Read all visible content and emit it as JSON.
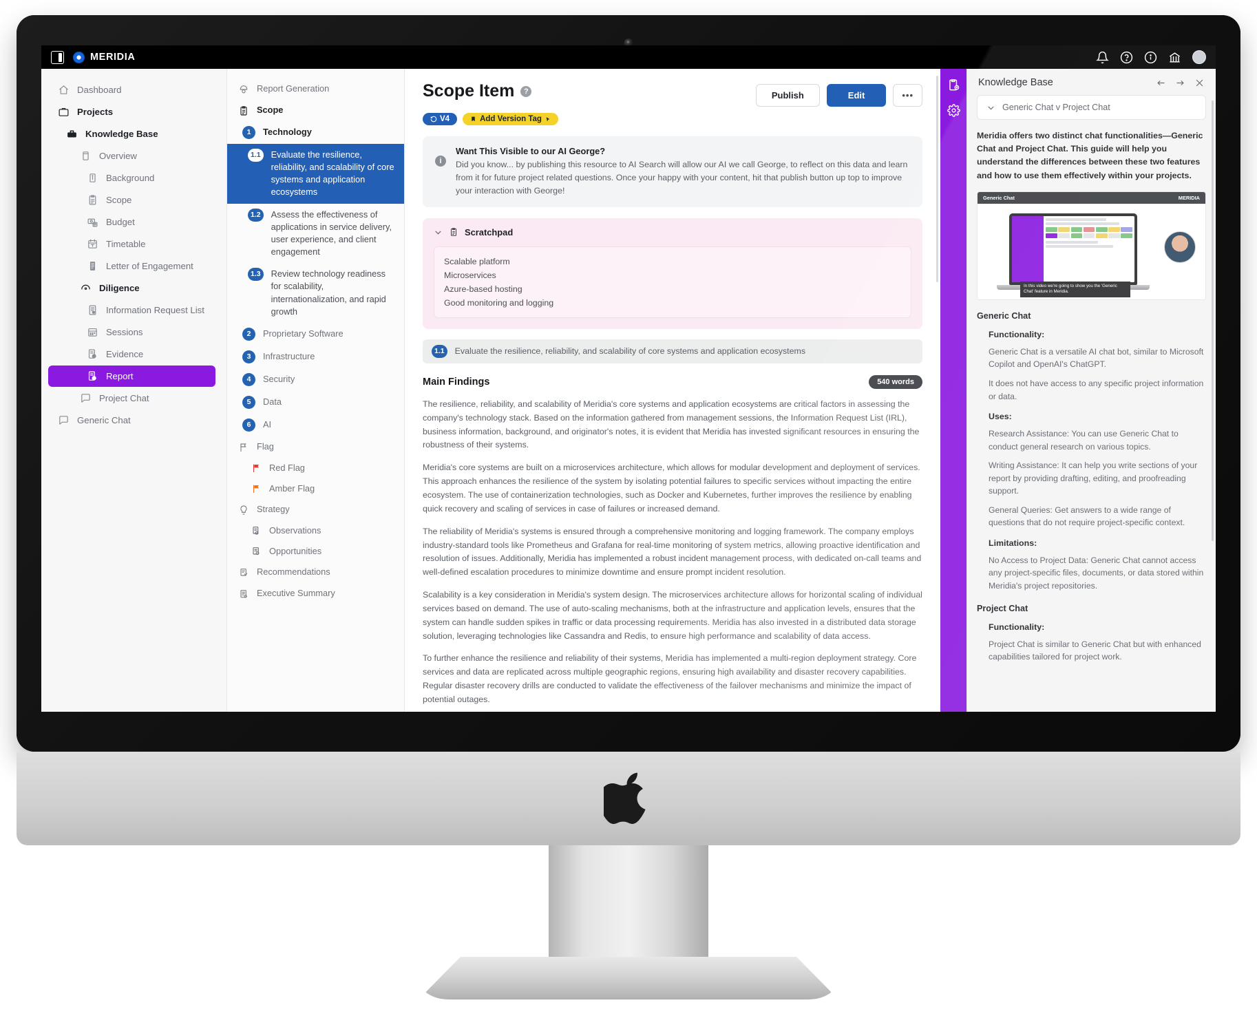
{
  "topbar": {
    "brand": "MERIDIA",
    "collapse_icon": "panel-collapse-icon",
    "icons": [
      "bell-icon",
      "help-circle-icon",
      "info-circle-icon",
      "bank-icon",
      "avatar"
    ]
  },
  "sidebar": {
    "items": [
      {
        "label": "Dashboard",
        "icon": "home-icon",
        "level": 0,
        "bold": false,
        "active": false
      },
      {
        "label": "Projects",
        "icon": "briefcase-icon",
        "level": 0,
        "bold": true,
        "active": false
      },
      {
        "label": "Knowledge Base",
        "icon": "toolbox-icon",
        "level": 1,
        "bold": true,
        "active": false
      },
      {
        "label": "Overview",
        "icon": "book-icon",
        "level": 2,
        "bold": false,
        "active": false
      },
      {
        "label": "Background",
        "icon": "info-doc-icon",
        "level": 3,
        "bold": false,
        "active": false
      },
      {
        "label": "Scope",
        "icon": "clipboard-icon",
        "level": 3,
        "bold": false,
        "active": false
      },
      {
        "label": "Budget",
        "icon": "money-icon",
        "level": 3,
        "bold": false,
        "active": false
      },
      {
        "label": "Timetable",
        "icon": "calendar-icon",
        "level": 3,
        "bold": false,
        "active": false
      },
      {
        "label": "Letter of Engagement",
        "icon": "document-icon",
        "level": 3,
        "bold": false,
        "active": false
      },
      {
        "label": "Diligence",
        "icon": "eye-icon",
        "level": 2,
        "bold": true,
        "active": false
      },
      {
        "label": "Information Request List",
        "icon": "list-doc-icon",
        "level": 3,
        "bold": false,
        "active": false
      },
      {
        "label": "Sessions",
        "icon": "grid-icon",
        "level": 3,
        "bold": false,
        "active": false
      },
      {
        "label": "Evidence",
        "icon": "evidence-icon",
        "level": 3,
        "bold": false,
        "active": false
      },
      {
        "label": "Report",
        "icon": "report-icon",
        "level": 3,
        "bold": false,
        "active": true
      },
      {
        "label": "Project Chat",
        "icon": "chat-icon",
        "level": 2,
        "bold": false,
        "active": false
      },
      {
        "label": "Generic Chat",
        "icon": "chat-icon",
        "level": 0,
        "bold": false,
        "active": false
      }
    ]
  },
  "tree": {
    "header": {
      "label": "Report Generation",
      "icon": "report-gen-icon"
    },
    "section": {
      "label": "Scope",
      "icon": "clipboard-icon"
    },
    "group": {
      "num": "1",
      "label": "Technology"
    },
    "sub_items": [
      {
        "num": "1.1",
        "label": "Evaluate the resilience, reliability, and scalability of core systems and application ecosystems",
        "selected": true
      },
      {
        "num": "1.2",
        "label": "Assess the effectiveness of applications in service delivery, user experience, and client engagement",
        "selected": false
      },
      {
        "num": "1.3",
        "label": "Review technology readiness for scalability, internationalization, and rapid growth",
        "selected": false
      }
    ],
    "top_items": [
      {
        "num": "2",
        "label": "Proprietary Software"
      },
      {
        "num": "3",
        "label": "Infrastructure"
      },
      {
        "num": "4",
        "label": "Security"
      },
      {
        "num": "5",
        "label": "Data"
      },
      {
        "num": "6",
        "label": "AI"
      }
    ],
    "flag_section": {
      "label": "Flag",
      "icon": "flag-outline-icon"
    },
    "flags": [
      {
        "label": "Red Flag",
        "color": "#e53935",
        "icon": "flag-icon"
      },
      {
        "label": "Amber Flag",
        "color": "#f4701f",
        "icon": "flag-icon"
      }
    ],
    "strategy_section": {
      "label": "Strategy",
      "icon": "lightbulb-icon"
    },
    "strategy_items": [
      {
        "label": "Observations",
        "icon": "observations-icon"
      },
      {
        "label": "Opportunities",
        "icon": "opportunities-icon"
      }
    ],
    "footer_items": [
      {
        "label": "Recommendations",
        "icon": "recommendations-icon"
      },
      {
        "label": "Executive Summary",
        "icon": "summary-icon"
      }
    ]
  },
  "main": {
    "title": "Scope Item",
    "help_icon": "help-circle-icon",
    "version_badge": "V4",
    "version_tag_label": "Add Version Tag",
    "buttons": {
      "publish": "Publish",
      "edit": "Edit",
      "more": "•••"
    },
    "info_card": {
      "title": "Want This Visible to our AI George?",
      "body": "Did you know... by publishing this resource to AI Search will allow our AI we call George, to reflect on this data and learn from it for future project related questions. Once your happy with your content, hit that publish button up top to improve your interaction with George!"
    },
    "scratchpad": {
      "title": "Scratchpad",
      "lines": [
        "Scalable platform",
        "Microservices",
        "Azure-based hosting",
        "Good monitoring and logging"
      ]
    },
    "item_strip": {
      "num": "1.1",
      "label": "Evaluate the resilience, reliability, and scalability of core systems and application ecosystems"
    },
    "findings_title": "Main Findings",
    "word_count": "540 words",
    "paragraphs": [
      "The resilience, reliability, and scalability of Meridia's core systems and application ecosystems are critical factors in assessing the company's technology stack. Based on the information gathered from management sessions, the Information Request List (IRL), business information, background, and originator's notes, it is evident that Meridia has invested significant resources in ensuring the robustness of their systems.",
      "Meridia's core systems are built on a microservices architecture, which allows for modular development and deployment of services. This approach enhances the resilience of the system by isolating potential failures to specific services without impacting the entire ecosystem. The use of containerization technologies, such as Docker and Kubernetes, further improves the resilience by enabling quick recovery and scaling of services in case of failures or increased demand.",
      "The reliability of Meridia's systems is ensured through a comprehensive monitoring and logging framework. The company employs industry-standard tools like Prometheus and Grafana for real-time monitoring of system metrics, allowing proactive identification and resolution of issues. Additionally, Meridia has implemented a robust incident management process, with dedicated on-call teams and well-defined escalation procedures to minimize downtime and ensure prompt incident resolution.",
      "Scalability is a key consideration in Meridia's system design. The microservices architecture allows for horizontal scaling of individual services based on demand. The use of auto-scaling mechanisms, both at the infrastructure and application levels, ensures that the system can handle sudden spikes in traffic or data processing requirements. Meridia has also invested in a distributed data storage solution, leveraging technologies like Cassandra and Redis, to ensure high performance and scalability of data access.",
      "To further enhance the resilience and reliability of their systems, Meridia has implemented a multi-region deployment strategy. Core services and data are replicated across multiple geographic regions, ensuring high availability and disaster recovery capabilities. Regular disaster recovery drills are conducted to validate the effectiveness of the failover mechanisms and minimize the impact of potential outages."
    ]
  },
  "rail": {
    "icons": [
      "knowledge-base-icon",
      "settings-gear-icon"
    ]
  },
  "knowledge_base": {
    "title": "Knowledge Base",
    "header_icons": [
      "collapse-horizontal-icon",
      "expand-horizontal-icon",
      "close-icon"
    ],
    "selector": "Generic Chat v Project Chat",
    "intro": "Meridia offers two distinct chat functionalities—Generic Chat and Project Chat. This guide will help you understand the differences between these two features and how to use them effectively within your projects.",
    "thumbnail": {
      "title": "Generic Chat",
      "brand": "MERIDIA",
      "caption": "In this video we're going to show you the 'Generic Chat' feature in Meridia."
    },
    "sections": [
      {
        "heading": "Generic Chat",
        "blocks": [
          {
            "type": "sub",
            "text": "Functionality:"
          },
          {
            "type": "p",
            "text": "Generic Chat is a versatile AI chat bot, similar to Microsoft Copilot and OpenAI's ChatGPT."
          },
          {
            "type": "p",
            "text": "It does not have access to any specific project information or data."
          },
          {
            "type": "sub",
            "text": "Uses:"
          },
          {
            "type": "p",
            "text": "Research Assistance: You can use Generic Chat to conduct general research on various topics."
          },
          {
            "type": "p",
            "text": "Writing Assistance: It can help you write sections of your report by providing drafting, editing, and proofreading support."
          },
          {
            "type": "p",
            "text": "General Queries: Get answers to a wide range of questions that do not require project-specific context."
          },
          {
            "type": "sub",
            "text": "Limitations:"
          },
          {
            "type": "p",
            "text": "No Access to Project Data: Generic Chat cannot access any project-specific files, documents, or data stored within Meridia's project repositories."
          }
        ]
      },
      {
        "heading": "Project Chat",
        "blocks": [
          {
            "type": "sub",
            "text": "Functionality:"
          },
          {
            "type": "p",
            "text": "Project Chat is similar to Generic Chat but with enhanced capabilities tailored for project work."
          }
        ]
      }
    ]
  },
  "colors": {
    "accent_purple": "#8b1ae0",
    "accent_blue": "#2360b5",
    "badge_yellow": "#f5d22a",
    "red_flag": "#e53935",
    "amber_flag": "#f4701f"
  }
}
